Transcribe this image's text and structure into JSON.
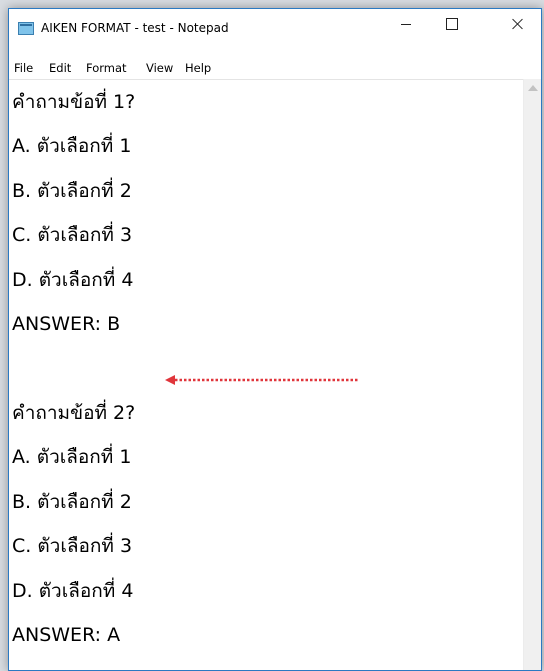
{
  "window": {
    "title": "AIKEN FORMAT - test - Notepad"
  },
  "menu": {
    "file": "File",
    "edit": "Edit",
    "format": "Format",
    "view": "View",
    "help": "Help"
  },
  "editor": {
    "lines": [
      "คำถามข้อที่ 1?",
      "A. ตัวเลือกที่ 1",
      "B. ตัวเลือกที่ 2",
      "C. ตัวเลือกที่ 3",
      "D. ตัวเลือกที่ 4",
      "ANSWER: B",
      "",
      "คำถามข้อที่ 2?",
      "A. ตัวเลือกที่ 1",
      "B. ตัวเลือกที่ 2",
      "C. ตัวเลือกที่ 3",
      "D. ตัวเลือกที่ 4",
      "ANSWER: A"
    ]
  },
  "annotation": {
    "arrow_color": "#e0353b",
    "arrow_icon": "dotted-left-arrow-icon"
  },
  "colors": {
    "window_border": "#2b79c2"
  }
}
